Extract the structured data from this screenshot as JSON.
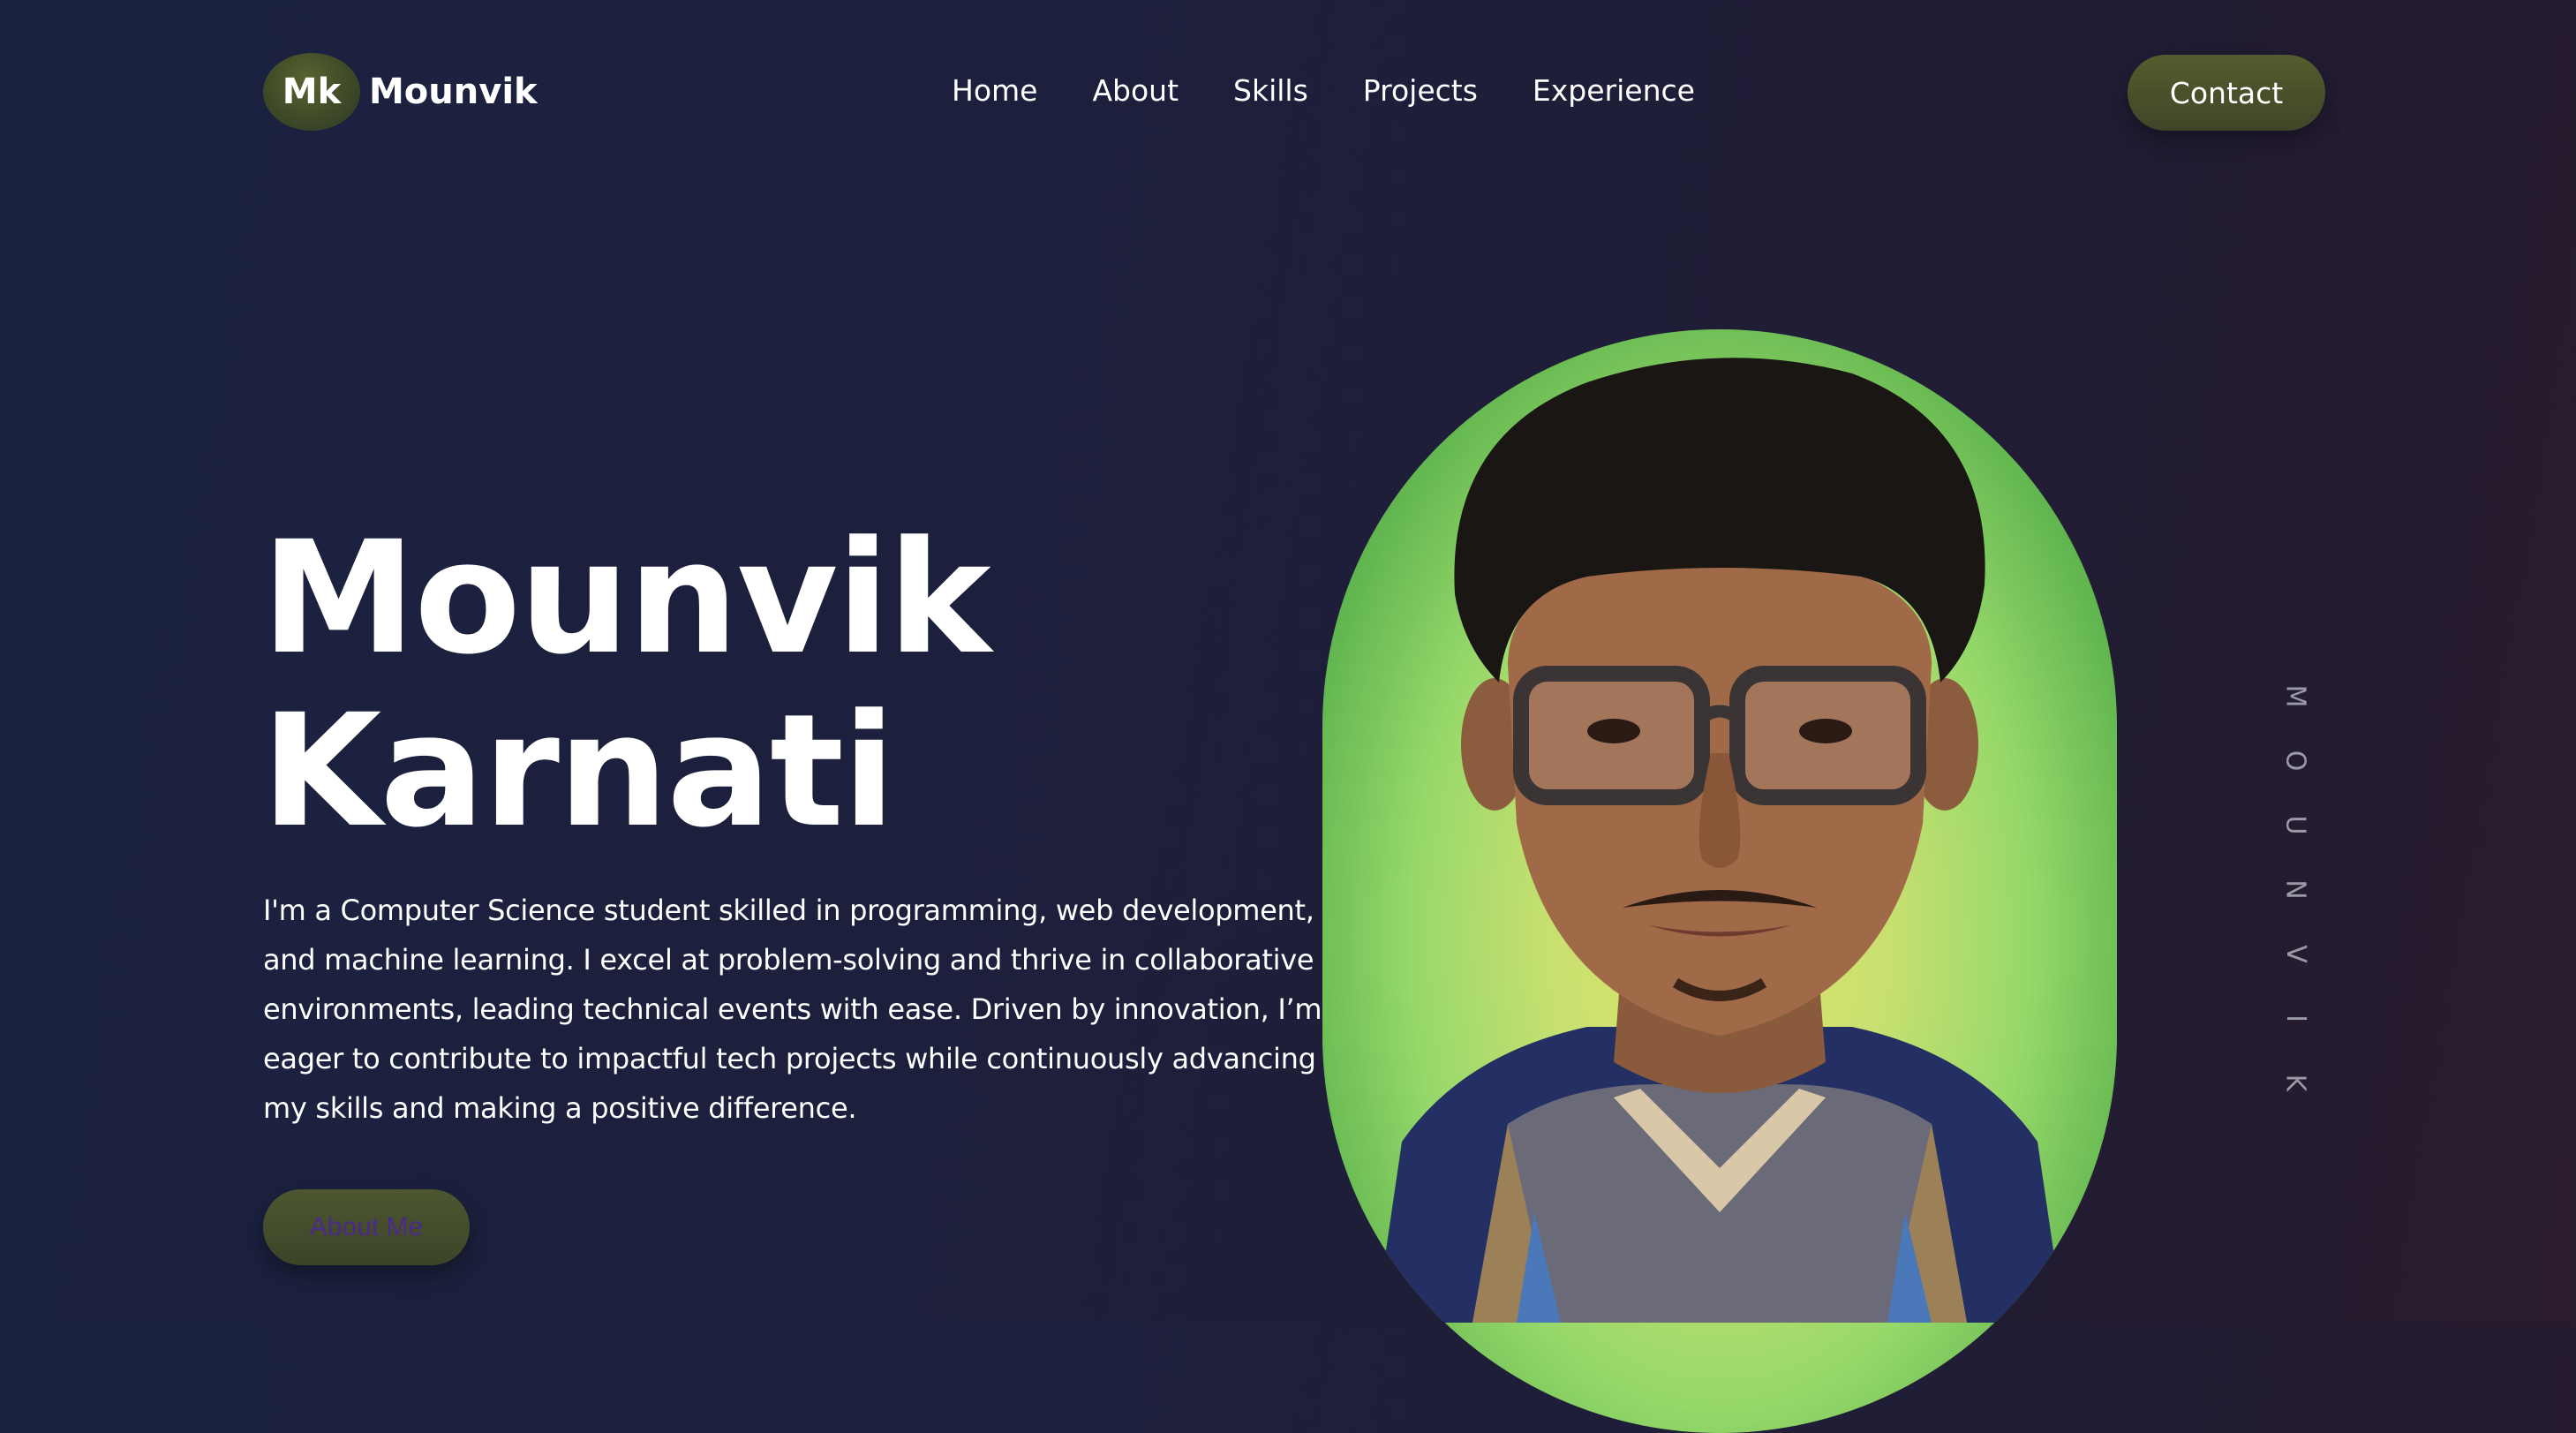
{
  "header": {
    "logo_badge": "Mk",
    "logo_name": "Mounvik",
    "nav": [
      "Home",
      "About",
      "Skills",
      "Projects",
      "Experience"
    ],
    "contact_label": "Contact"
  },
  "hero": {
    "first_name": "Mounvik",
    "last_name": "Karnati",
    "description": "I'm a Computer Science student skilled in programming, web development, and machine learning. I excel at problem-solving and thrive in collaborative environments, leading technical events with ease. Driven by innovation, I’m eager to contribute to impactful tech projects while continuously advancing my skills and making a positive difference.",
    "about_button_label": "About Me"
  },
  "side_text": [
    "M",
    "O",
    "U",
    "N",
    "V",
    "I",
    "K"
  ],
  "colors": {
    "background": "#1d1f3b",
    "accent_button": "#4a5430",
    "about_label": "#4a2a8a",
    "portrait_glow": "#c8e070"
  }
}
